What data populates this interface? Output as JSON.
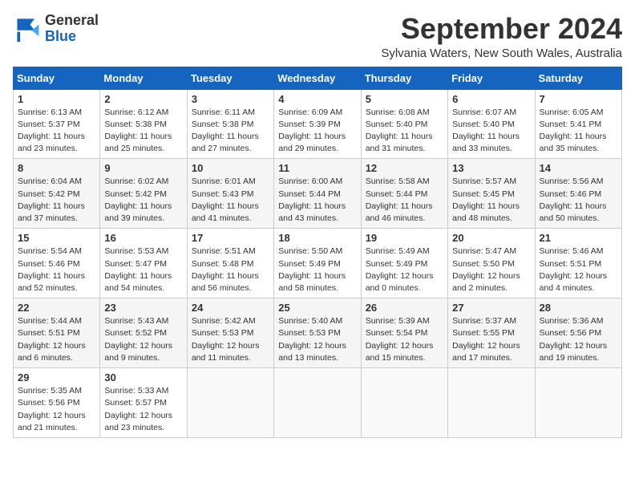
{
  "logo": {
    "general": "General",
    "blue": "Blue"
  },
  "header": {
    "month": "September 2024",
    "location": "Sylvania Waters, New South Wales, Australia"
  },
  "days_of_week": [
    "Sunday",
    "Monday",
    "Tuesday",
    "Wednesday",
    "Thursday",
    "Friday",
    "Saturday"
  ],
  "weeks": [
    [
      {
        "day": 1,
        "info": "Sunrise: 6:13 AM\nSunset: 5:37 PM\nDaylight: 11 hours\nand 23 minutes."
      },
      {
        "day": 2,
        "info": "Sunrise: 6:12 AM\nSunset: 5:38 PM\nDaylight: 11 hours\nand 25 minutes."
      },
      {
        "day": 3,
        "info": "Sunrise: 6:11 AM\nSunset: 5:38 PM\nDaylight: 11 hours\nand 27 minutes."
      },
      {
        "day": 4,
        "info": "Sunrise: 6:09 AM\nSunset: 5:39 PM\nDaylight: 11 hours\nand 29 minutes."
      },
      {
        "day": 5,
        "info": "Sunrise: 6:08 AM\nSunset: 5:40 PM\nDaylight: 11 hours\nand 31 minutes."
      },
      {
        "day": 6,
        "info": "Sunrise: 6:07 AM\nSunset: 5:40 PM\nDaylight: 11 hours\nand 33 minutes."
      },
      {
        "day": 7,
        "info": "Sunrise: 6:05 AM\nSunset: 5:41 PM\nDaylight: 11 hours\nand 35 minutes."
      }
    ],
    [
      {
        "day": 8,
        "info": "Sunrise: 6:04 AM\nSunset: 5:42 PM\nDaylight: 11 hours\nand 37 minutes."
      },
      {
        "day": 9,
        "info": "Sunrise: 6:02 AM\nSunset: 5:42 PM\nDaylight: 11 hours\nand 39 minutes."
      },
      {
        "day": 10,
        "info": "Sunrise: 6:01 AM\nSunset: 5:43 PM\nDaylight: 11 hours\nand 41 minutes."
      },
      {
        "day": 11,
        "info": "Sunrise: 6:00 AM\nSunset: 5:44 PM\nDaylight: 11 hours\nand 43 minutes."
      },
      {
        "day": 12,
        "info": "Sunrise: 5:58 AM\nSunset: 5:44 PM\nDaylight: 11 hours\nand 46 minutes."
      },
      {
        "day": 13,
        "info": "Sunrise: 5:57 AM\nSunset: 5:45 PM\nDaylight: 11 hours\nand 48 minutes."
      },
      {
        "day": 14,
        "info": "Sunrise: 5:56 AM\nSunset: 5:46 PM\nDaylight: 11 hours\nand 50 minutes."
      }
    ],
    [
      {
        "day": 15,
        "info": "Sunrise: 5:54 AM\nSunset: 5:46 PM\nDaylight: 11 hours\nand 52 minutes."
      },
      {
        "day": 16,
        "info": "Sunrise: 5:53 AM\nSunset: 5:47 PM\nDaylight: 11 hours\nand 54 minutes."
      },
      {
        "day": 17,
        "info": "Sunrise: 5:51 AM\nSunset: 5:48 PM\nDaylight: 11 hours\nand 56 minutes."
      },
      {
        "day": 18,
        "info": "Sunrise: 5:50 AM\nSunset: 5:49 PM\nDaylight: 11 hours\nand 58 minutes."
      },
      {
        "day": 19,
        "info": "Sunrise: 5:49 AM\nSunset: 5:49 PM\nDaylight: 12 hours\nand 0 minutes."
      },
      {
        "day": 20,
        "info": "Sunrise: 5:47 AM\nSunset: 5:50 PM\nDaylight: 12 hours\nand 2 minutes."
      },
      {
        "day": 21,
        "info": "Sunrise: 5:46 AM\nSunset: 5:51 PM\nDaylight: 12 hours\nand 4 minutes."
      }
    ],
    [
      {
        "day": 22,
        "info": "Sunrise: 5:44 AM\nSunset: 5:51 PM\nDaylight: 12 hours\nand 6 minutes."
      },
      {
        "day": 23,
        "info": "Sunrise: 5:43 AM\nSunset: 5:52 PM\nDaylight: 12 hours\nand 9 minutes."
      },
      {
        "day": 24,
        "info": "Sunrise: 5:42 AM\nSunset: 5:53 PM\nDaylight: 12 hours\nand 11 minutes."
      },
      {
        "day": 25,
        "info": "Sunrise: 5:40 AM\nSunset: 5:53 PM\nDaylight: 12 hours\nand 13 minutes."
      },
      {
        "day": 26,
        "info": "Sunrise: 5:39 AM\nSunset: 5:54 PM\nDaylight: 12 hours\nand 15 minutes."
      },
      {
        "day": 27,
        "info": "Sunrise: 5:37 AM\nSunset: 5:55 PM\nDaylight: 12 hours\nand 17 minutes."
      },
      {
        "day": 28,
        "info": "Sunrise: 5:36 AM\nSunset: 5:56 PM\nDaylight: 12 hours\nand 19 minutes."
      }
    ],
    [
      {
        "day": 29,
        "info": "Sunrise: 5:35 AM\nSunset: 5:56 PM\nDaylight: 12 hours\nand 21 minutes."
      },
      {
        "day": 30,
        "info": "Sunrise: 5:33 AM\nSunset: 5:57 PM\nDaylight: 12 hours\nand 23 minutes."
      },
      null,
      null,
      null,
      null,
      null
    ]
  ]
}
